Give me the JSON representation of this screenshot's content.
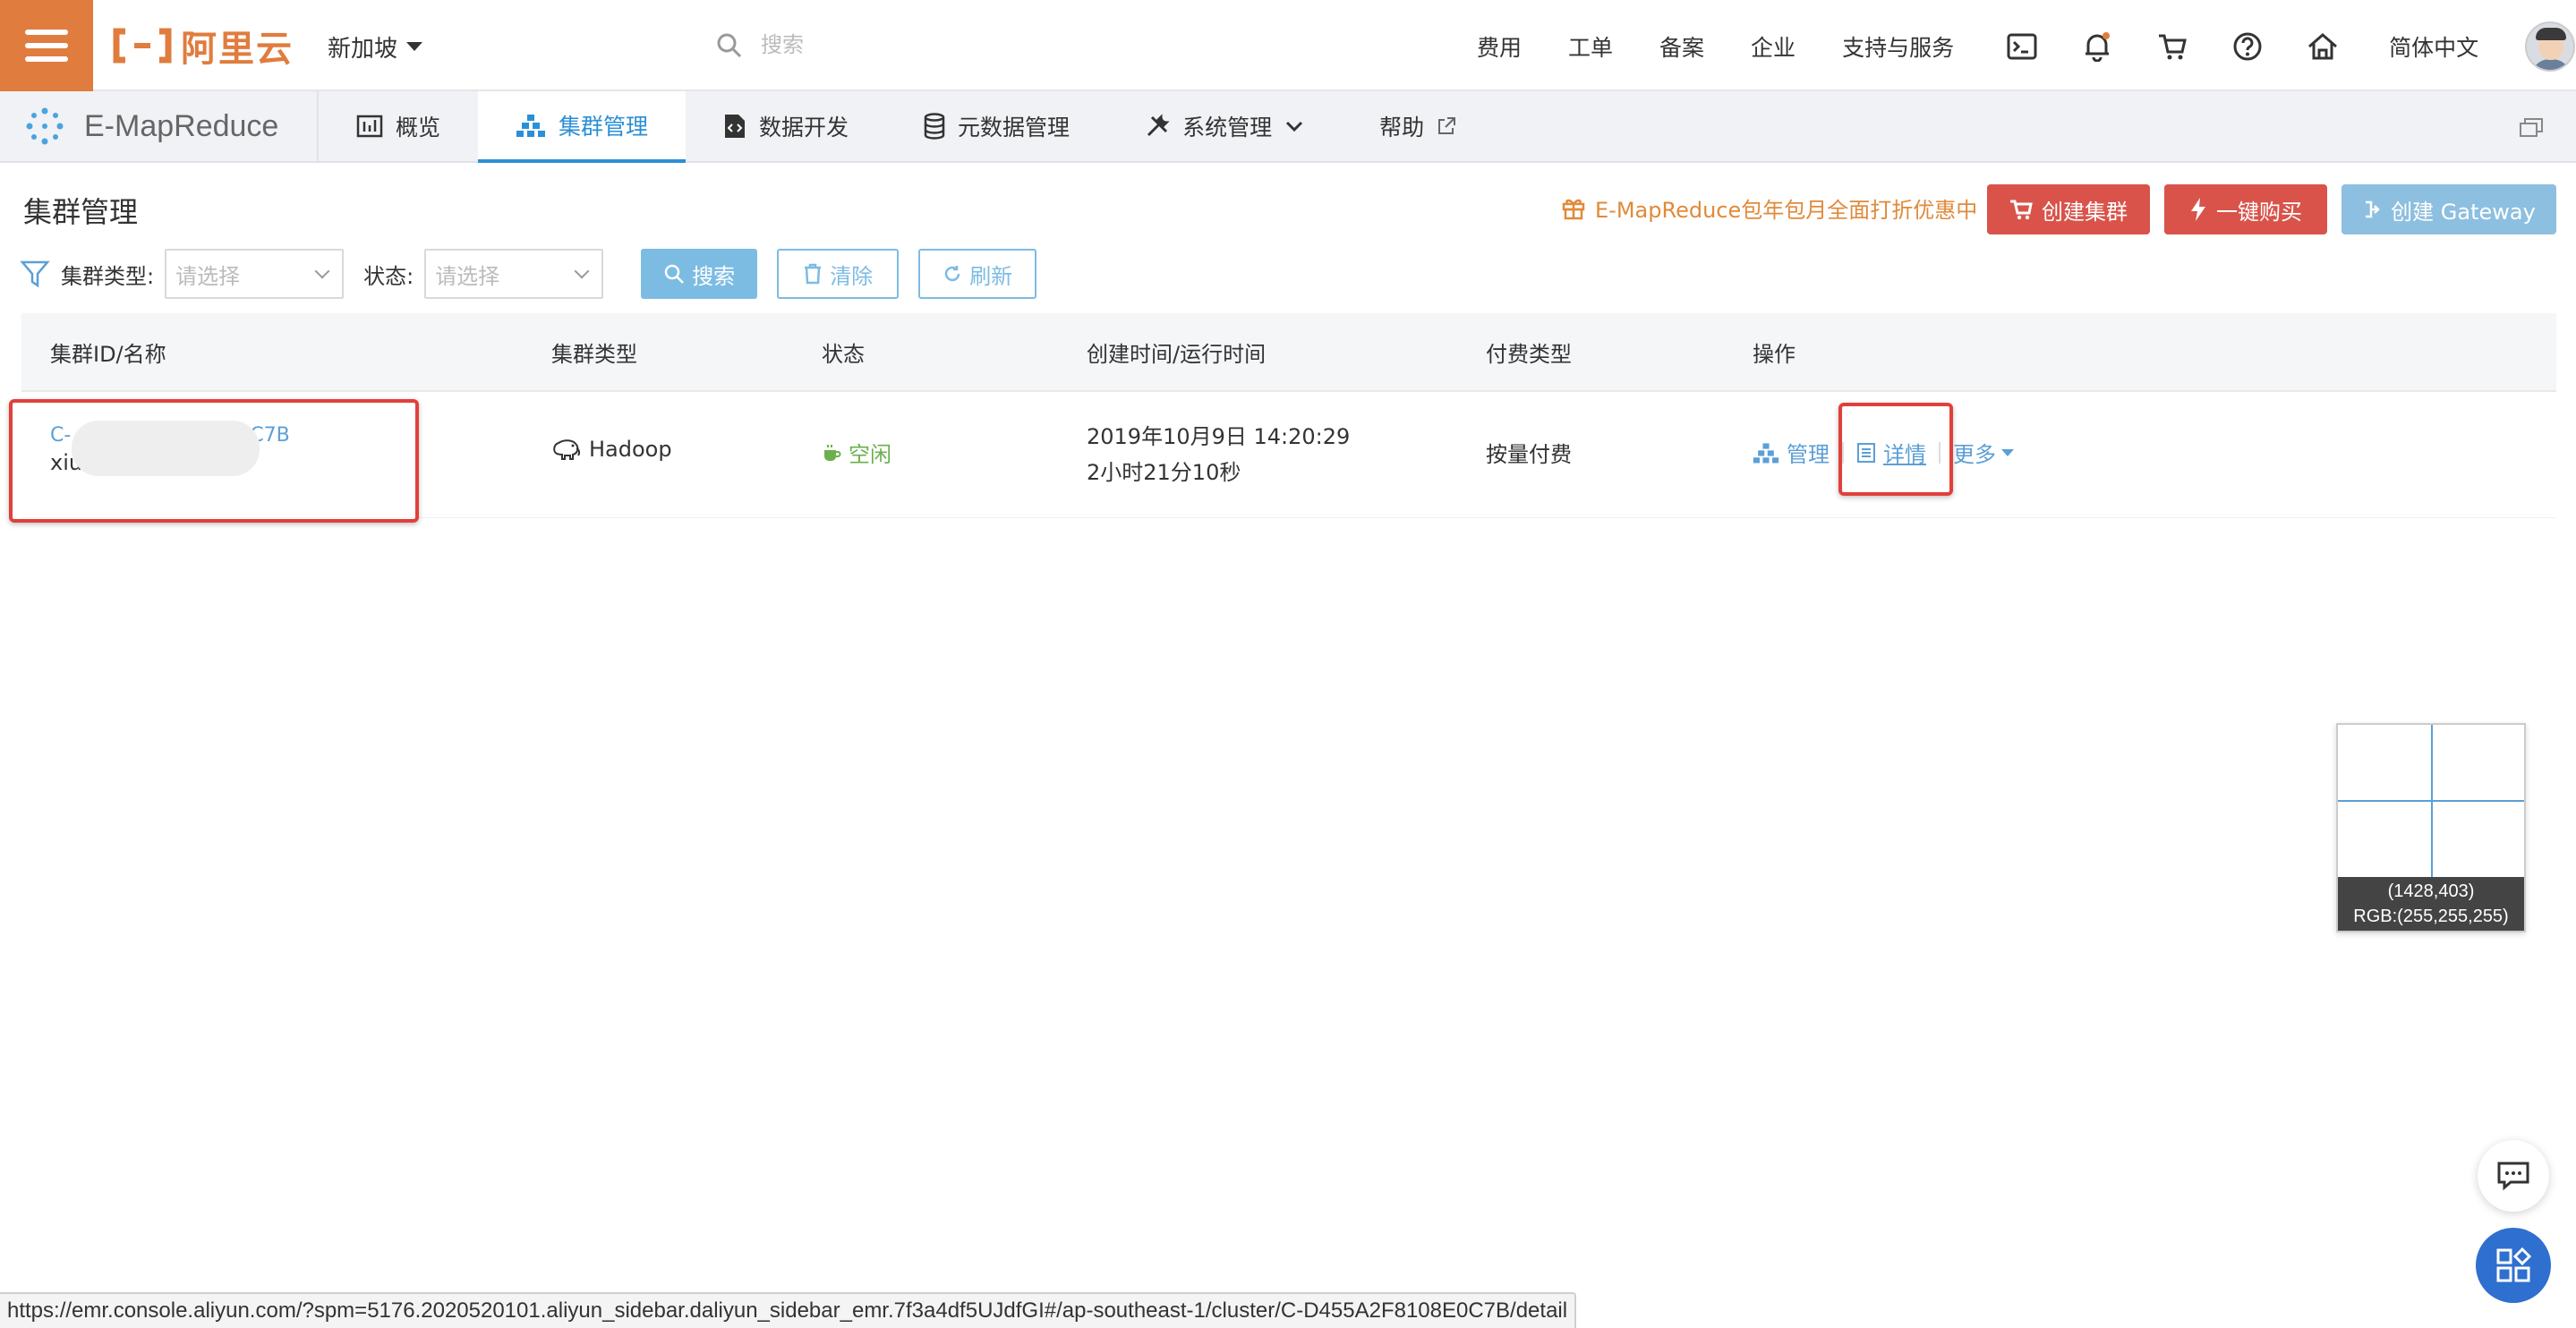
{
  "topbar": {
    "logo_text": "阿里云",
    "region": "新加坡",
    "search_placeholder": "搜索",
    "nav": [
      "费用",
      "工单",
      "备案",
      "企业",
      "支持与服务"
    ],
    "language": "简体中文",
    "icons": [
      "terminal-icon",
      "bell-icon",
      "cart-icon",
      "help-icon",
      "home-icon"
    ]
  },
  "product": {
    "name": "E-MapReduce",
    "tabs": [
      {
        "label": "概览",
        "icon": "bar-chart-icon"
      },
      {
        "label": "集群管理",
        "icon": "cluster-icon",
        "active": true
      },
      {
        "label": "数据开发",
        "icon": "code-file-icon"
      },
      {
        "label": "元数据管理",
        "icon": "database-icon"
      },
      {
        "label": "系统管理",
        "icon": "tools-icon"
      },
      {
        "label": "帮助",
        "icon": "external-link-icon"
      }
    ]
  },
  "page": {
    "title": "集群管理",
    "promo": "E-MapReduce包年包月全面打折优惠中",
    "create_cluster": "创建集群",
    "one_click_buy": "一键购买",
    "create_gateway": "创建 Gateway"
  },
  "filters": {
    "cluster_type_label": "集群类型:",
    "cluster_type_placeholder": "请选择",
    "status_label": "状态:",
    "status_placeholder": "请选择",
    "search": "搜索",
    "clear": "清除",
    "refresh": "刷新"
  },
  "table": {
    "headers": [
      "集群ID/名称",
      "集群类型",
      "状态",
      "创建时间/运行时间",
      "付费类型",
      "操作"
    ],
    "rows": [
      {
        "id_prefix": "C-",
        "id_suffix": "C7B",
        "name_prefix": "xiu",
        "type": "Hadoop",
        "status": "空闲",
        "created": "2019年10月9日 14:20:29",
        "runtime": "2小时21分10秒",
        "billing": "按量付费",
        "op_manage": "管理",
        "op_detail": "详情",
        "op_more": "更多"
      }
    ]
  },
  "picker": {
    "coords": "(1428,403)",
    "rgb": "RGB:(255,255,255)"
  },
  "status_url": "https://emr.console.aliyun.com/?spm=5176.2020520101.aliyun_sidebar.daliyun_sidebar_emr.7f3a4df5UJdfGI#/ap-southeast-1/cluster/C-D455A2F8108E0C7B/detail",
  "colors": {
    "brand_orange": "#e07c3e",
    "primary_blue": "#2b8fd6",
    "danger_red": "#d9534a",
    "idle_green": "#6ab04c",
    "highlight_box": "#e0403a"
  }
}
